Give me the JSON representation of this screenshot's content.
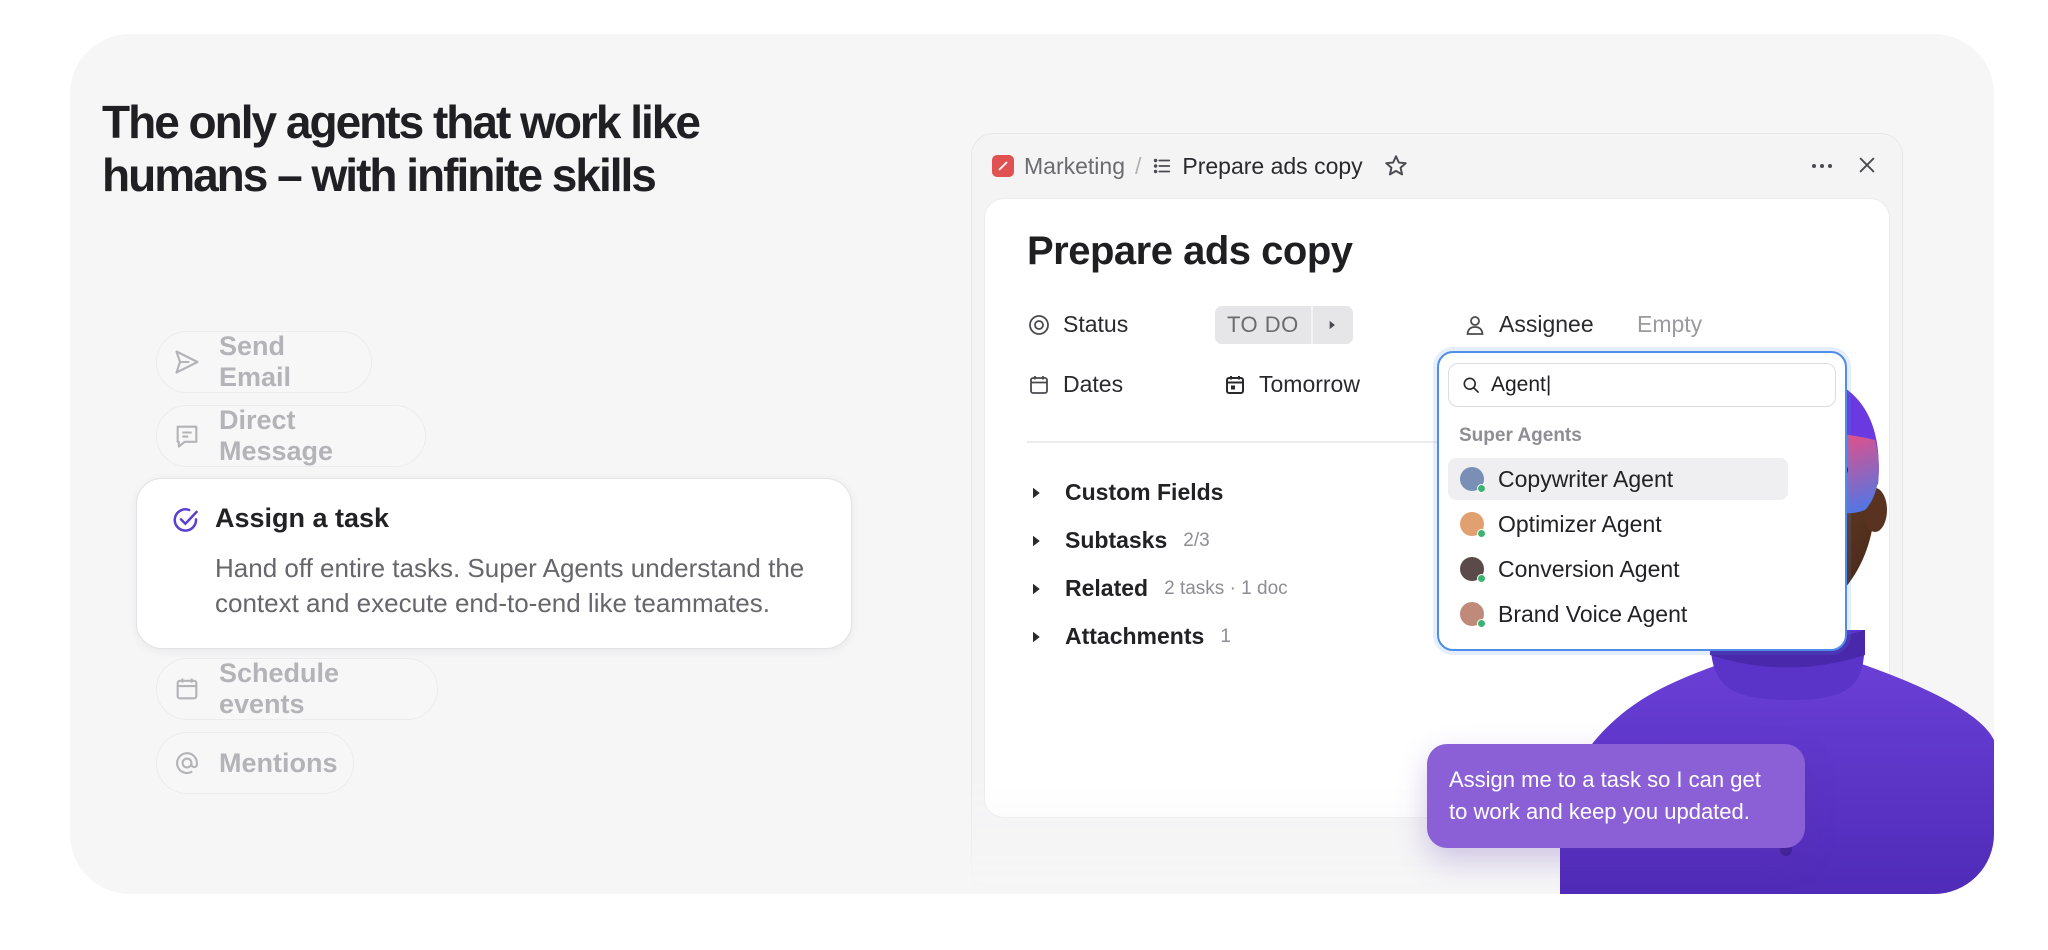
{
  "headline": "The only agents that work like humans – with infinite skills",
  "features": {
    "send_email": "Send Email",
    "direct_message": "Direct Message",
    "assign_task": {
      "title": "Assign a task",
      "description": "Hand off entire tasks. Super Agents understand the context and execute end-to-end like teammates."
    },
    "schedule_events": "Schedule events",
    "mentions": "Mentions"
  },
  "task_window": {
    "breadcrumb": {
      "space": "Marketing",
      "separator": "/",
      "list": "Prepare ads copy"
    },
    "title": "Prepare ads copy",
    "status": {
      "label": "Status",
      "value": "TO DO"
    },
    "assignee": {
      "label": "Assignee",
      "value": "Empty"
    },
    "dates": {
      "label": "Dates",
      "value": "Tomorrow"
    },
    "sections": [
      {
        "label": "Custom Fields",
        "meta": ""
      },
      {
        "label": "Subtasks",
        "meta": "2/3"
      },
      {
        "label": "Related",
        "meta": "2 tasks · 1 doc"
      },
      {
        "label": "Attachments",
        "meta": "1"
      }
    ]
  },
  "assignee_dropdown": {
    "search_value": "Agent|",
    "group_label": "Super Agents",
    "items": [
      {
        "name": "Copywriter Agent",
        "avatar_color": "#7a8fb5"
      },
      {
        "name": "Optimizer Agent",
        "avatar_color": "#e0a070"
      },
      {
        "name": "Conversion Agent",
        "avatar_color": "#5a4a4a"
      },
      {
        "name": "Brand Voice Agent",
        "avatar_color": "#c08a7a"
      }
    ]
  },
  "chat_bubble": "Assign me to a task so I can get to work and keep you updated.",
  "colors": {
    "accent": "#8b5fd6",
    "focus": "#4f8de8",
    "brand_red": "#e05252",
    "online": "#3cb371"
  }
}
